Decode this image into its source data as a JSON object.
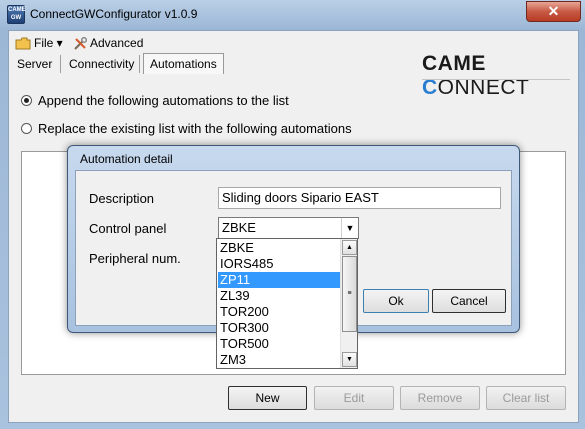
{
  "window": {
    "title": "ConnectGWConfigurator v1.0.9",
    "close_glyph": "✕",
    "icon_text": "CAME GW"
  },
  "menu": {
    "file": "File ▾",
    "advanced": "Advanced"
  },
  "tabs": [
    {
      "label": "Server"
    },
    {
      "label": "Connectivity"
    },
    {
      "label": "Automations"
    }
  ],
  "logo": {
    "part1": "CAME",
    "ring": "C",
    "part2": "ONNECT"
  },
  "options": {
    "append": "Append the following automations to the list",
    "replace": "Replace the existing list with the following automations"
  },
  "buttons": {
    "new": "New",
    "edit": "Edit",
    "remove": "Remove",
    "clear": "Clear list"
  },
  "dialog": {
    "title": "Automation detail",
    "description_label": "Description",
    "description_value": "Sliding doors Sipario EAST",
    "control_panel_label": "Control panel",
    "control_panel_value": "ZBKE",
    "peripheral_label": "Peripheral num.",
    "ok": "Ok",
    "cancel": "Cancel"
  },
  "dropdown": {
    "items": [
      "ZBKE",
      "IORS485",
      "ZP11",
      "ZL39",
      "TOR200",
      "TOR300",
      "TOR500",
      "ZM3"
    ],
    "selected": "ZP11"
  },
  "colors": {
    "selection": "#3399ff",
    "logo_accent": "#2a7ed1",
    "close": "#c75a44"
  }
}
